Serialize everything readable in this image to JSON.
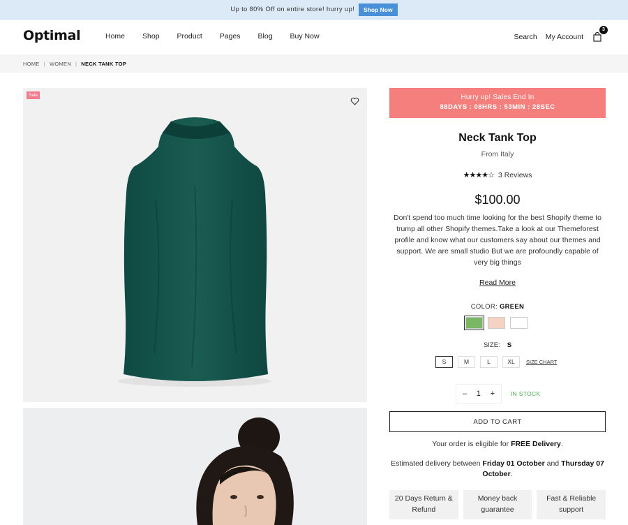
{
  "topbar": {
    "text": "Up to 80% Off on entire store! hurry up!",
    "button": "Shop Now"
  },
  "header": {
    "logo": "Optimal",
    "nav": [
      "Home",
      "Shop",
      "Product",
      "Pages",
      "Blog",
      "Buy Now"
    ],
    "search": "Search",
    "account": "My Account",
    "cart_count": "3"
  },
  "breadcrumb": {
    "home": "HOME",
    "women": "WOMEN",
    "current": "NECK TANK TOP"
  },
  "gallery": {
    "sale_badge": "Sale",
    "icons": [
      "heart-icon"
    ]
  },
  "countdown": {
    "title": "Hurry up! Sales End In",
    "time": "88DAYS : 08HRS : 53MIN : 28SEC",
    "color": "#f47f7c"
  },
  "product": {
    "title": "Neck Tank Top",
    "origin": "From Italy",
    "stars": "★★★★☆",
    "rating_value": 4,
    "reviews": "3 Reviews",
    "price": "$100.00",
    "description": "Don't spend too much time looking for the best Shopify theme to trump all other Shopify themes.Take a look at our Themeforest profile and know what our customers say about our themes and support. We are small studio But we are profoundly capable of very big things",
    "read_more": "Read More",
    "color_label": "COLOR:",
    "color_value": "GREEN",
    "swatches": [
      "#7ab765",
      "#f4d3c4",
      "#ffffff"
    ],
    "size_label": "SIZE:",
    "size_value": "S",
    "sizes": [
      "S",
      "M",
      "L",
      "XL"
    ],
    "size_chart": "SIZE CHART",
    "qty_minus": "–",
    "qty": "1",
    "qty_plus": "+",
    "stock": "IN STOCK",
    "add_to_cart": "ADD TO CART",
    "free_prefix": "Your order is eligible for",
    "free_bold": "FREE Delivery",
    "free_suffix": ".",
    "estimate_prefix": "Estimated delivery between",
    "estimate_start": "Friday 01 October",
    "estimate_mid": "and",
    "estimate_end": "Thursday 07 October",
    "estimate_suffix": ".",
    "features": [
      "20 Days Return & Refund",
      "Money back guarantee",
      "Fast & Reliable support"
    ]
  }
}
